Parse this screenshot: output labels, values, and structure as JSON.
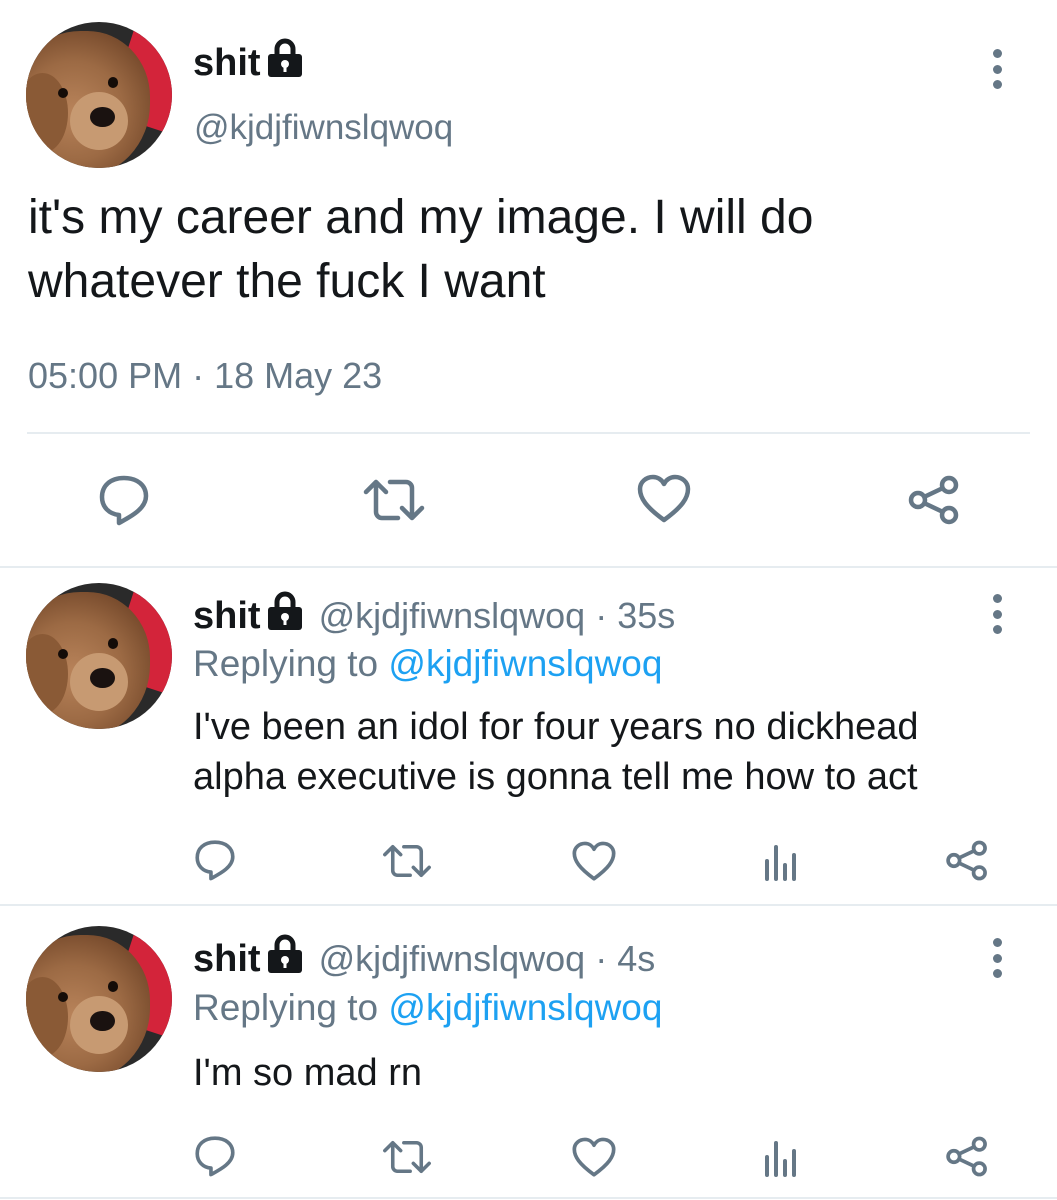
{
  "main_tweet": {
    "display_name": "shit",
    "handle": "@kjdjfiwnslqwoq",
    "text_line1": "it's my career and my image. I will do",
    "text_line2": "whatever the fuck I want",
    "timestamp": "05:00 PM · 18 May 23"
  },
  "replies": [
    {
      "display_name": "shit",
      "handle_time": "@kjdjfiwnslqwoq · 35s",
      "replying_prefix": "Replying to ",
      "replying_to": "@kjdjfiwnslqwoq",
      "text_line1": "I've been an idol for four years no dickhead",
      "text_line2": "alpha executive is gonna tell me how to act"
    },
    {
      "display_name": "shit",
      "handle_time": "@kjdjfiwnslqwoq · 4s",
      "replying_prefix": "Replying to ",
      "replying_to": "@kjdjfiwnslqwoq",
      "text_line1": "I'm so mad rn"
    }
  ],
  "icons": [
    "lock-icon",
    "more-icon",
    "reply-icon",
    "retweet-icon",
    "like-icon",
    "analytics-icon",
    "share-icon"
  ],
  "colors": {
    "text": "#14171a",
    "secondary": "#657786",
    "link": "#1da1f2",
    "divider": "#e6ecf0"
  }
}
